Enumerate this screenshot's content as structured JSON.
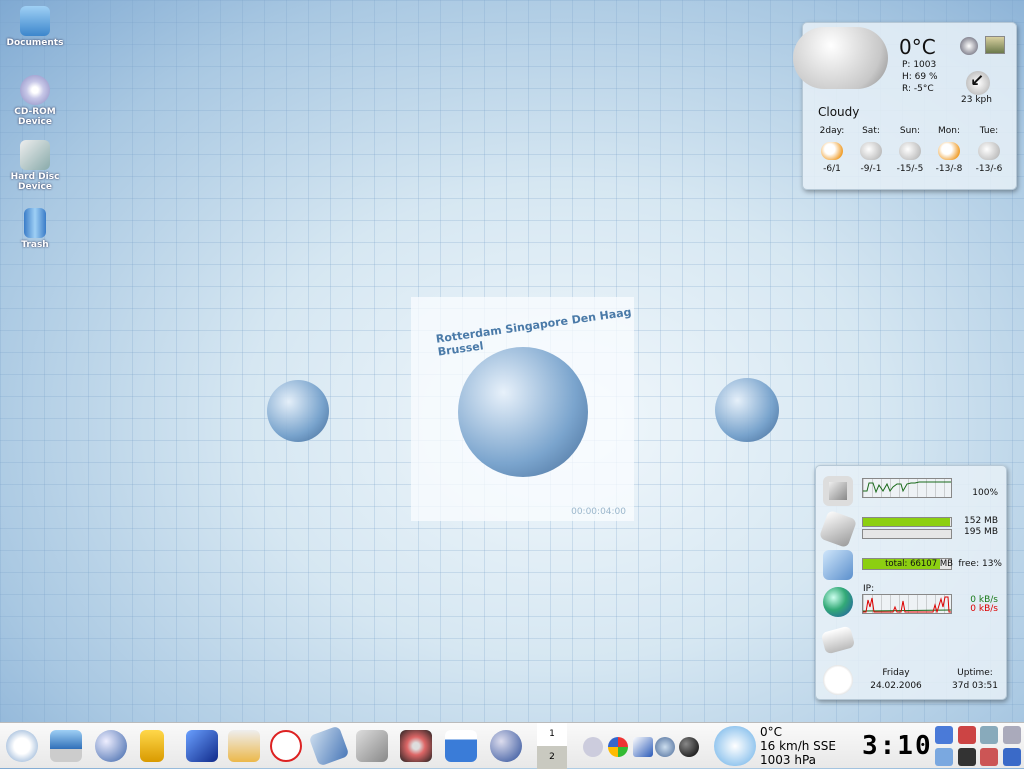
{
  "desktop_icons": [
    {
      "label": "Documents"
    },
    {
      "label": "CD-ROM Device"
    },
    {
      "label": "Hard Disc Device"
    },
    {
      "label": "Trash"
    }
  ],
  "screensaver": {
    "cities": "Rotterdam  Singapore  Den Haag  Brussel",
    "time": "00:00:04:00"
  },
  "weather": {
    "temp": "0°C",
    "pressure": "P:  1003",
    "humidity": "H:  69 %",
    "real": "R:  -5°C",
    "wind": "23 kph",
    "condition": "Cloudy",
    "forecast": [
      {
        "day": "2day:",
        "temps": "-6/1",
        "icon": "sun-cloud"
      },
      {
        "day": "Sat:",
        "temps": "-9/-1",
        "icon": "snow-cloud"
      },
      {
        "day": "Sun:",
        "temps": "-15/-5",
        "icon": "snow-cloud"
      },
      {
        "day": "Mon:",
        "temps": "-13/-8",
        "icon": "sun-cloud"
      },
      {
        "day": "Tue:",
        "temps": "-13/-6",
        "icon": "snow-cloud"
      }
    ]
  },
  "sysmon": {
    "cpu": "100%",
    "mem_used": "152 MB",
    "swap": "195 MB",
    "mem_fraction": 0.99,
    "swap_fraction": 0,
    "disk_total": "total: 66107 MB",
    "disk_free": "free: 13%",
    "disk_fraction": 0.87,
    "net_label": "IP:",
    "net_in": "0 kB/s",
    "net_out": "0 kB/s",
    "day": "Friday",
    "date": "24.02.2006",
    "uptime_label": "Uptime:",
    "uptime": "37d 03:51"
  },
  "taskbar": {
    "pager": [
      "1",
      "2"
    ],
    "weather_temp": "0°C",
    "weather_wind": "16 km/h SSE",
    "weather_pressure": "1003 hPa",
    "clock": "3:10"
  },
  "colors": {
    "cpu_graph": "#1a6a1a",
    "net_in": "#1a7a1a",
    "net_out": "#dd0000",
    "bar_fill": "#8ccf10"
  }
}
